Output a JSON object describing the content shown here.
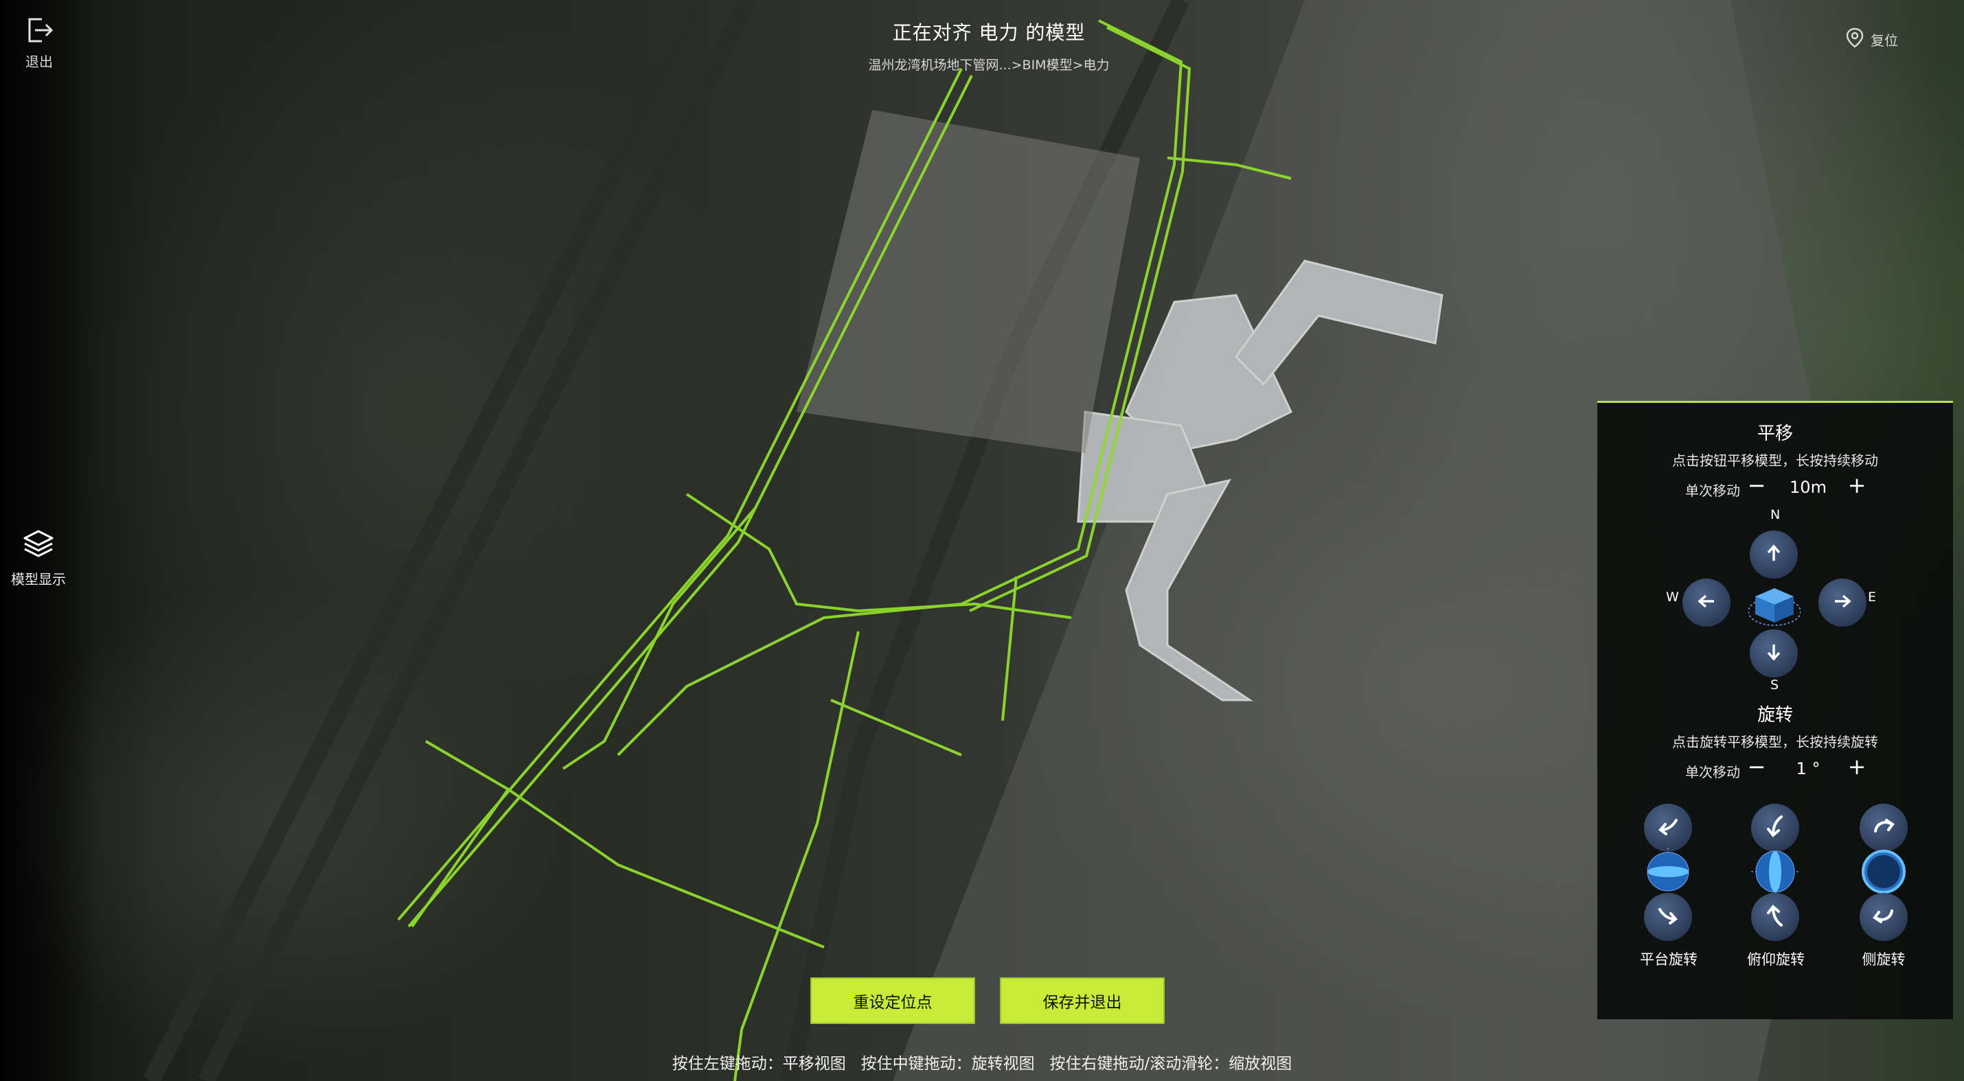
{
  "header": {
    "title": "正在对齐 电力 的模型",
    "path": "温州龙湾机场地下管网...>BIM模型>电力"
  },
  "exit": {
    "label": "退出",
    "icon": "exit-icon"
  },
  "reset": {
    "label": "复位",
    "icon": "location-pin-icon"
  },
  "model_display": {
    "label": "模型显示",
    "icon": "layers-icon"
  },
  "panel": {
    "accent_color": "#b8e34a",
    "translate": {
      "title": "平移",
      "hint": "点击按钮平移模型，长按持续移动",
      "step_label": "单次移动",
      "step_value": "10m",
      "minus": "−",
      "plus": "+",
      "compass": {
        "n": "N",
        "s": "S",
        "w": "W",
        "e": "E"
      }
    },
    "rotate": {
      "title": "旋转",
      "hint": "点击旋转平移模型，长按持续旋转",
      "step_label": "单次移动",
      "step_value": "1 °",
      "minus": "−",
      "plus": "+",
      "groups": [
        {
          "label": "平台旋转"
        },
        {
          "label": "俯仰旋转"
        },
        {
          "label": "侧旋转"
        }
      ]
    }
  },
  "buttons": {
    "reset_point": "重设定位点",
    "save_exit": "保存并退出",
    "color": "#c6ec36"
  },
  "footer_hint": "按住左键拖动：平移视图   按住中键拖动：旋转视图   按住右键拖动/滚动滑轮：缩放视图"
}
